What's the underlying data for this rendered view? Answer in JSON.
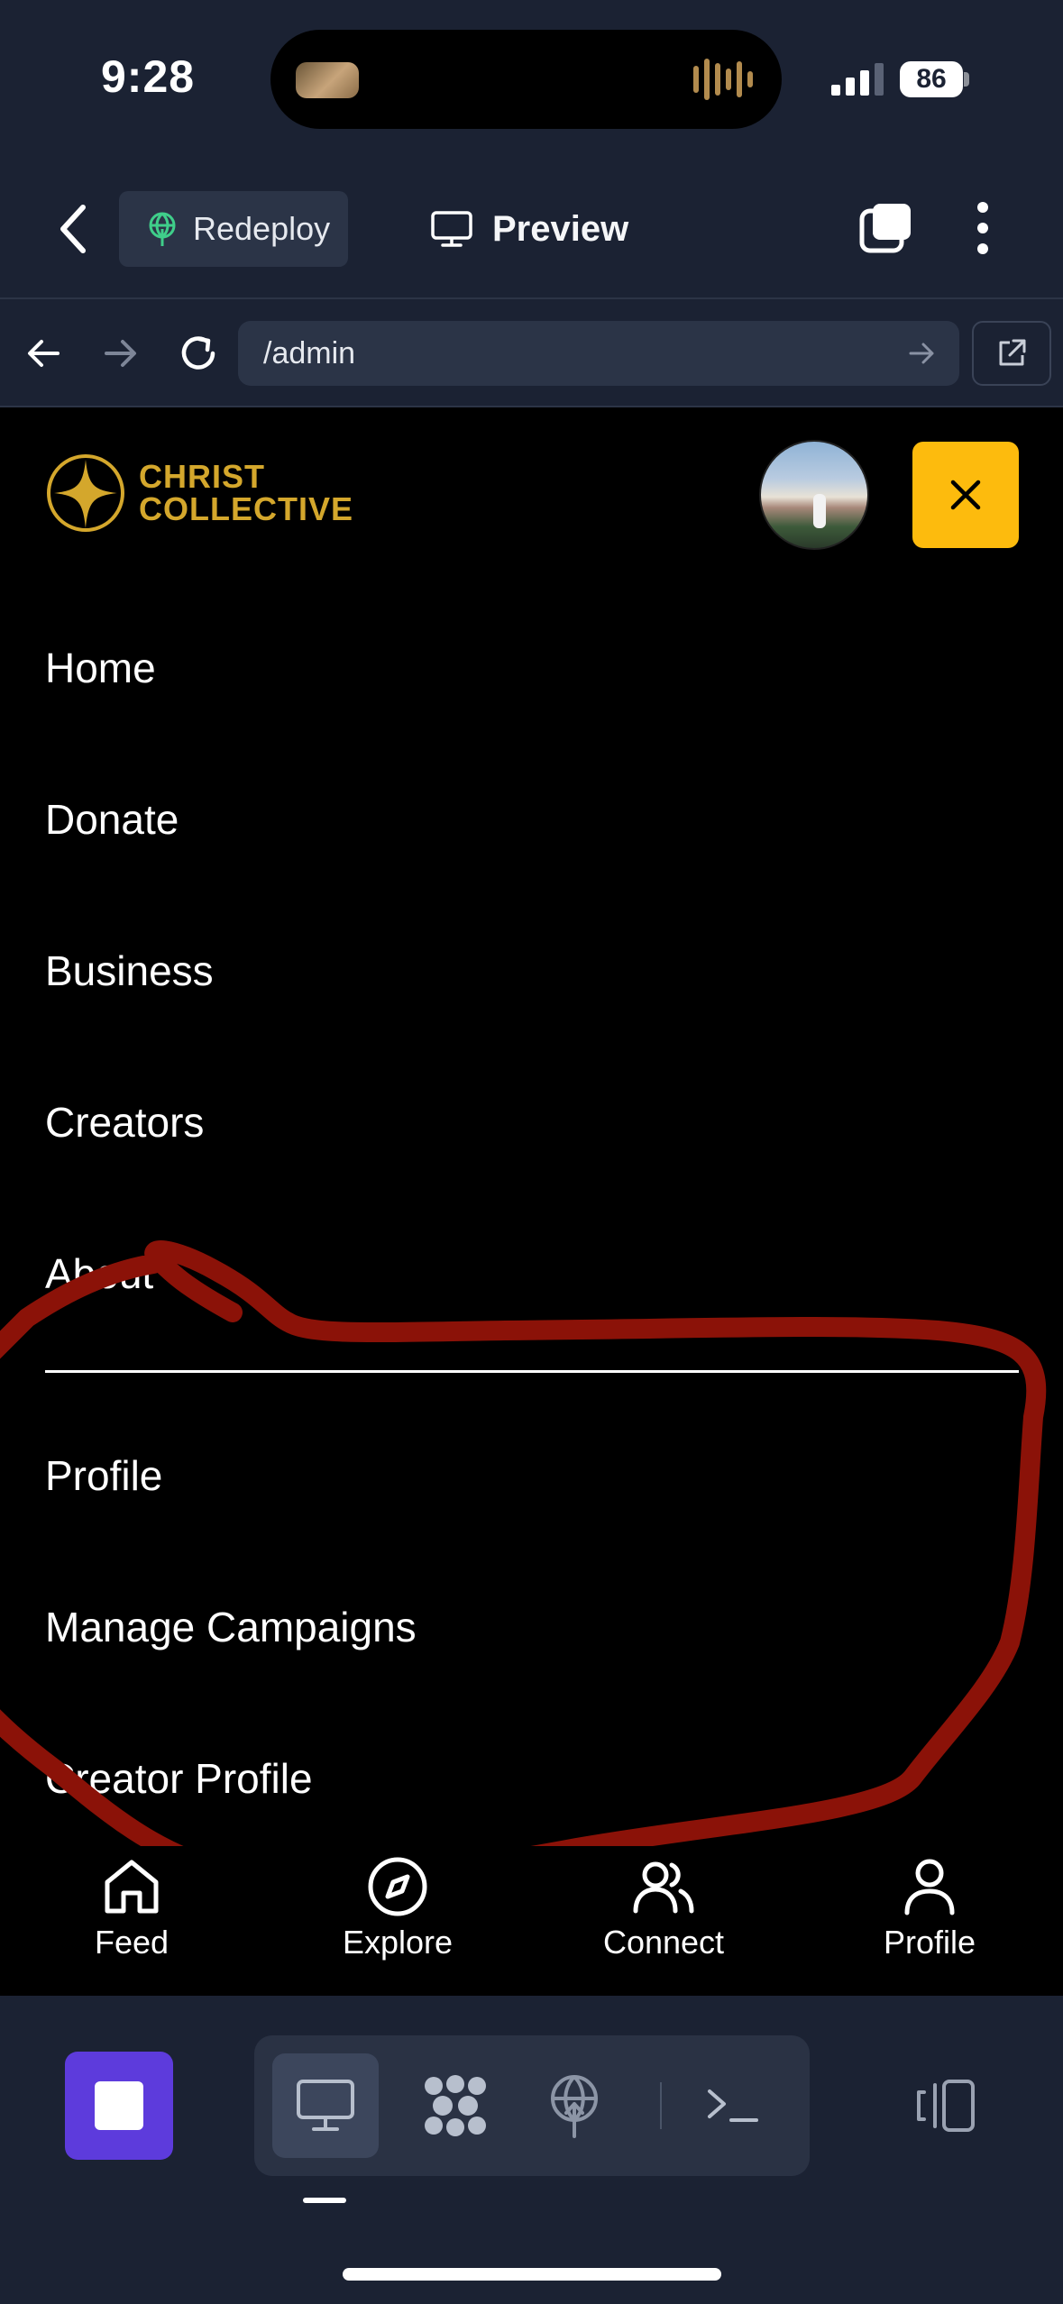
{
  "status_bar": {
    "time": "9:28",
    "battery": "86"
  },
  "top_bar": {
    "redeploy_label": "Redeploy",
    "preview_label": "Preview"
  },
  "url_bar": {
    "url": "/admin"
  },
  "site": {
    "logo_line1": "CHRIST",
    "logo_line2": "COLLECTIVE",
    "brand_color": "#d4a72c",
    "close_button_color": "#fdbb0d"
  },
  "menu": {
    "items": [
      {
        "label": "Home"
      },
      {
        "label": "Donate"
      },
      {
        "label": "Business"
      },
      {
        "label": "Creators"
      },
      {
        "label": "About"
      }
    ],
    "account_items": [
      {
        "label": "Profile"
      },
      {
        "label": "Manage Campaigns"
      },
      {
        "label": "Creator Profile"
      }
    ]
  },
  "bottom_nav": {
    "items": [
      {
        "label": "Feed",
        "icon": "home-icon"
      },
      {
        "label": "Explore",
        "icon": "compass-icon"
      },
      {
        "label": "Connect",
        "icon": "users-icon"
      },
      {
        "label": "Profile",
        "icon": "user-icon"
      }
    ]
  },
  "dock": {
    "stop_color": "#5d3bdc",
    "tools": [
      "preview-icon",
      "agent-icon",
      "deploy-icon",
      "shell-icon"
    ]
  },
  "annotation_color": "#8b1208"
}
